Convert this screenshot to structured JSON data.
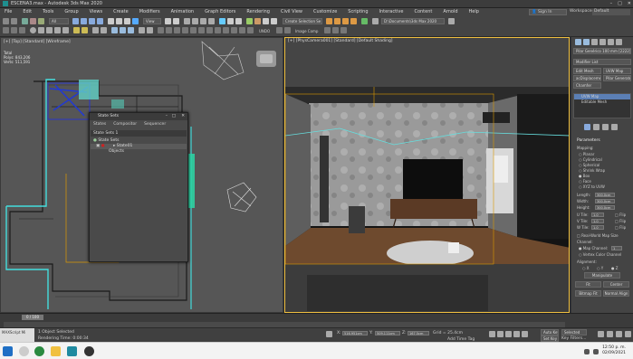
{
  "window": {
    "title": "ESCENA3.max - Autodesk 3ds Max 2020"
  },
  "menu": [
    "File",
    "Edit",
    "Tools",
    "Group",
    "Views",
    "Create",
    "Modifiers",
    "Animation",
    "Graph Editors",
    "Rendering",
    "Civil View",
    "Customize",
    "Scripting",
    "Interactive",
    "Content",
    "Arnold",
    "Help"
  ],
  "account": {
    "signin": "Sign In",
    "workspaces_label": "Workspaces:",
    "workspace_value": "Default"
  },
  "toolbar": {
    "create_selection_set": "Create Selection Se",
    "path": "D:\\Documents\\3ds Max 2020",
    "view_dropdown": "View",
    "undo_label": "UNDO",
    "image_comp": "Image Comp"
  },
  "viewports": {
    "left": {
      "label": "[+] [Top] [Standard] [Wireframe]",
      "stats": [
        "Total",
        "Polys: 843,206",
        "Verts: 511,591"
      ]
    },
    "right": {
      "label": "[+] [PhysCamera001] [Standard] [Default Shading]"
    }
  },
  "state_sets": {
    "title": "State Sets",
    "menu": [
      "States",
      "Compositor",
      "Sequencer"
    ],
    "header": "State Sets 1",
    "rows": [
      "State Sets",
      "State01",
      "Objects"
    ]
  },
  "command_panel": {
    "object_name": "Pilar Genérico 100 mm [2222]",
    "modifier_list": "Modifier List",
    "buttons": [
      "Edit Mesh",
      "UVW Map",
      "acDisplacement Mi",
      "Pilar Generator",
      "Chamfer"
    ],
    "stack": [
      "UVW Map",
      "Editable Mesh"
    ],
    "parameters_title": "Parameters",
    "mapping_label": "Mapping:",
    "mapping_options": [
      "Planar",
      "Cylindrical",
      "Spherical",
      "Shrink Wrap",
      "Box",
      "Face",
      "XYZ to UVW"
    ],
    "selected_mapping": "Box",
    "length_label": "Length:",
    "length": "300.0cm",
    "width_label": "Width:",
    "width": "300.0cm",
    "height_label": "Height:",
    "height": "300.0cm",
    "utile_label": "U Tile:",
    "utile": "1.0",
    "vtile_label": "V Tile:",
    "vtile": "1.0",
    "wtile_label": "W Tile:",
    "wtile": "1.0",
    "flip_label": "Flip",
    "real_world": "Real-World Map Size",
    "channel_label": "Channel:",
    "map_channel_label": "Map Channel:",
    "map_channel": "1",
    "vertex_color": "Vertex Color Channel",
    "alignment_label": "Alignment:",
    "axes": [
      "X",
      "Y",
      "Z"
    ],
    "manipulate": "Manipulate",
    "fit": "Fit",
    "center": "Center",
    "bitmap_fit": "Bitmap Fit",
    "normal_align": "Normal Align"
  },
  "timeline": {
    "frame": "0 / 100"
  },
  "status": {
    "maxscript": "MAXScript Mi",
    "selected": "1 Object Selected",
    "rendering": "Rendering Time: 0:00:34",
    "x_label": "X:",
    "x": "516.951cm",
    "y_label": "Y:",
    "y": "509.111cm",
    "z_label": "Z:",
    "z": "167.5cm",
    "grid": "Grid = 25.4cm",
    "add_time_tag": "Add Time Tag",
    "autokey": "Auto Key",
    "setkey": "Set Key",
    "selected_dd": "Selected",
    "key_filters": "Key Filters..."
  },
  "taskbar": {
    "time": "12:50 p. m.",
    "date": "02/09/2021"
  }
}
